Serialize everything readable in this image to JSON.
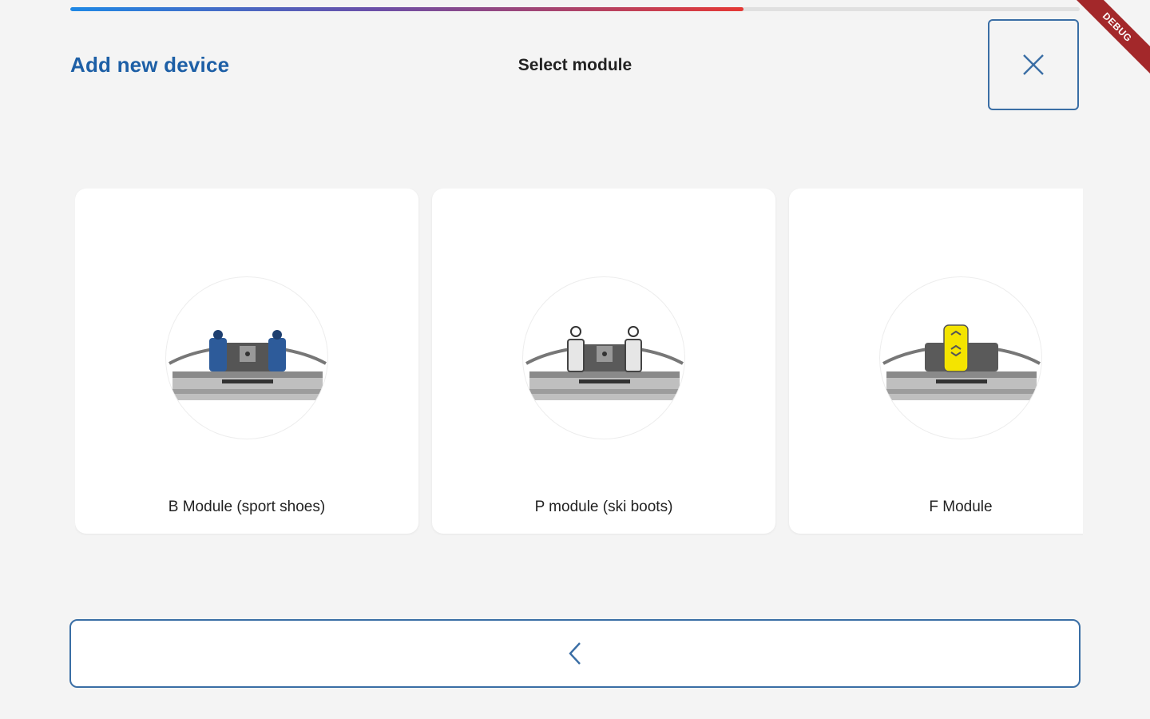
{
  "progress": {
    "fraction": 0.667
  },
  "header": {
    "title": "Add new device",
    "step_title": "Select module",
    "close_icon": "close-icon"
  },
  "debug_banner": "DEBUG",
  "modules": [
    {
      "label": "B Module (sport shoes)",
      "icon": "b-module-image",
      "accent": "#2d5b9a"
    },
    {
      "label": "P module (ski boots)",
      "icon": "p-module-image",
      "accent": "#e0e0e0"
    },
    {
      "label": "F Module",
      "icon": "f-module-image",
      "accent": "#f4e400"
    }
  ],
  "footer": {
    "back_icon": "chevron-left-icon"
  },
  "colors": {
    "brand_blue": "#1d5fa6",
    "border_blue": "#3a6ea5",
    "progress_start": "#1e88e5",
    "progress_end": "#e53935"
  }
}
